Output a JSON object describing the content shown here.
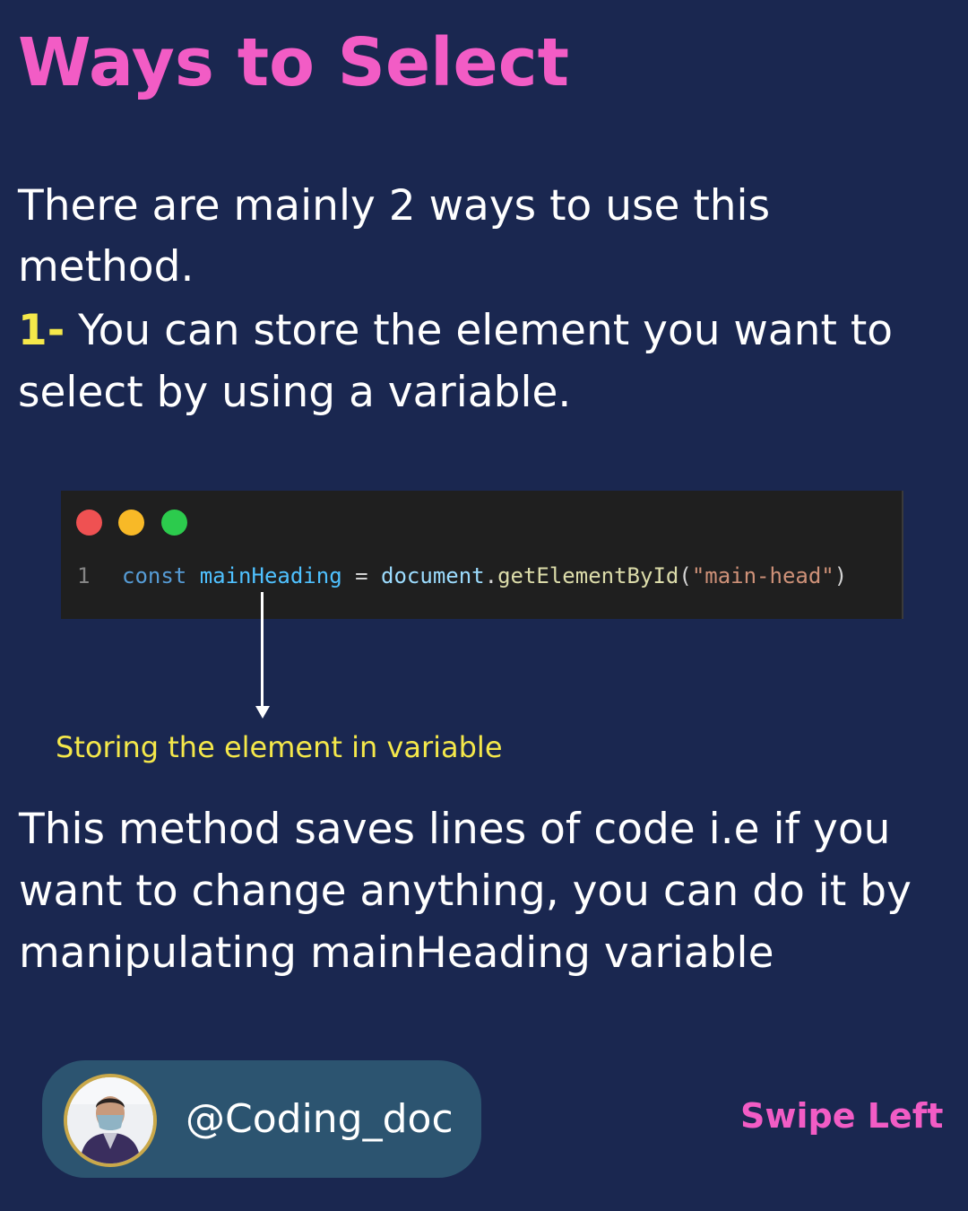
{
  "title": "Ways to Select",
  "intro": "There are mainly 2 ways to use this method.",
  "step": {
    "number": "1-",
    "text": "You can store the element you want to select by using a variable."
  },
  "code": {
    "line_number": "1",
    "keyword": "const",
    "variable": "mainHeading",
    "operator": "=",
    "object": "document",
    "dot": ".",
    "method": "getElementById",
    "open_paren": "(",
    "argument": "\"main-head\"",
    "close_paren": ")"
  },
  "caption": "Storing the element in variable",
  "explanation": "This method saves lines of code i.e if you want to change anything, you can do it by manipulating mainHeading variable",
  "profile": {
    "handle": "@Coding_doc"
  },
  "swipe_label": "Swipe Left",
  "colors": {
    "background": "#1a2750",
    "accent_pink": "#f25cc5",
    "accent_yellow": "#f5e84a",
    "pill": "#2c5470"
  }
}
